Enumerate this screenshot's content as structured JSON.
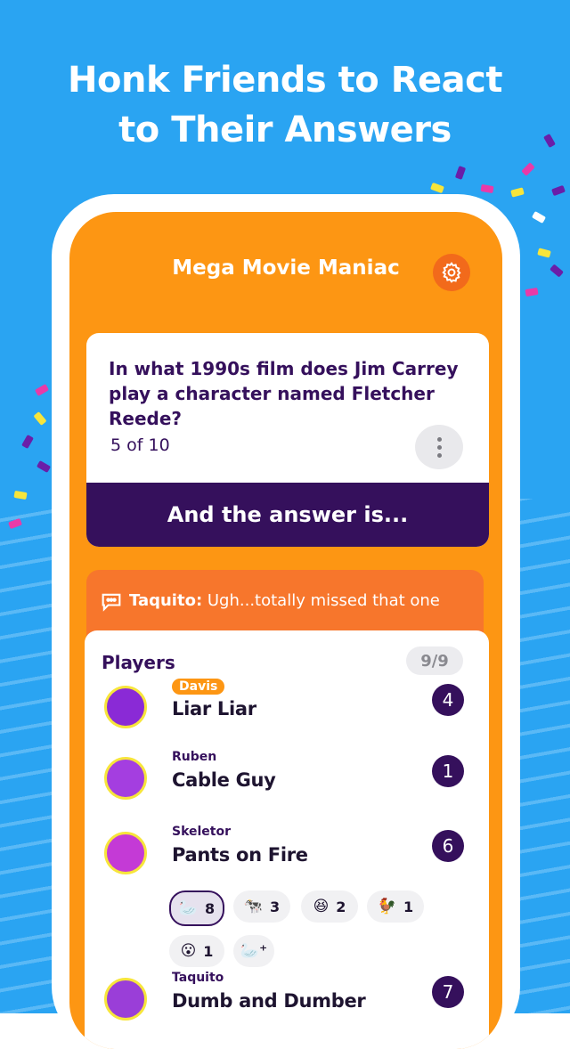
{
  "headline": {
    "line1": "Honk Friends to React",
    "line2": "to Their Answers"
  },
  "game": {
    "title": "Mega Movie Maniac",
    "settings_icon": "gear-icon"
  },
  "question": {
    "text": "In what 1990s film does Jim Carrey play a character named Fletcher Reede?",
    "progress": "5 of 10",
    "more_icon": "more-vertical-icon",
    "reveal_label": "And the answer is..."
  },
  "chat": {
    "author": "Taquito:",
    "message": " Ugh...totally missed that one",
    "icon": "chat-bubble-icon"
  },
  "players": {
    "title": "Players",
    "count": "9/9",
    "list": [
      {
        "name": "Davis",
        "answer": "Liar Liar",
        "score": "4"
      },
      {
        "name": "Ruben",
        "answer": "Cable Guy",
        "score": "1"
      },
      {
        "name": "Skeletor",
        "answer": "Pants on Fire",
        "score": "6"
      },
      {
        "name": "Taquito",
        "answer": "Dumb and Dumber",
        "score": "7"
      }
    ],
    "reactions": [
      {
        "emoji": "🦢",
        "count": "8"
      },
      {
        "emoji": "🐄",
        "count": "3"
      },
      {
        "emoji": "😆",
        "count": "2"
      },
      {
        "emoji": "🐓",
        "count": "1"
      },
      {
        "emoji": "😮",
        "count": "1"
      },
      {
        "emoji": "🦢⁺",
        "count": ""
      }
    ]
  },
  "colors": {
    "background": "#2aa4f2",
    "orange": "#fd9613",
    "purple": "#35105c"
  }
}
